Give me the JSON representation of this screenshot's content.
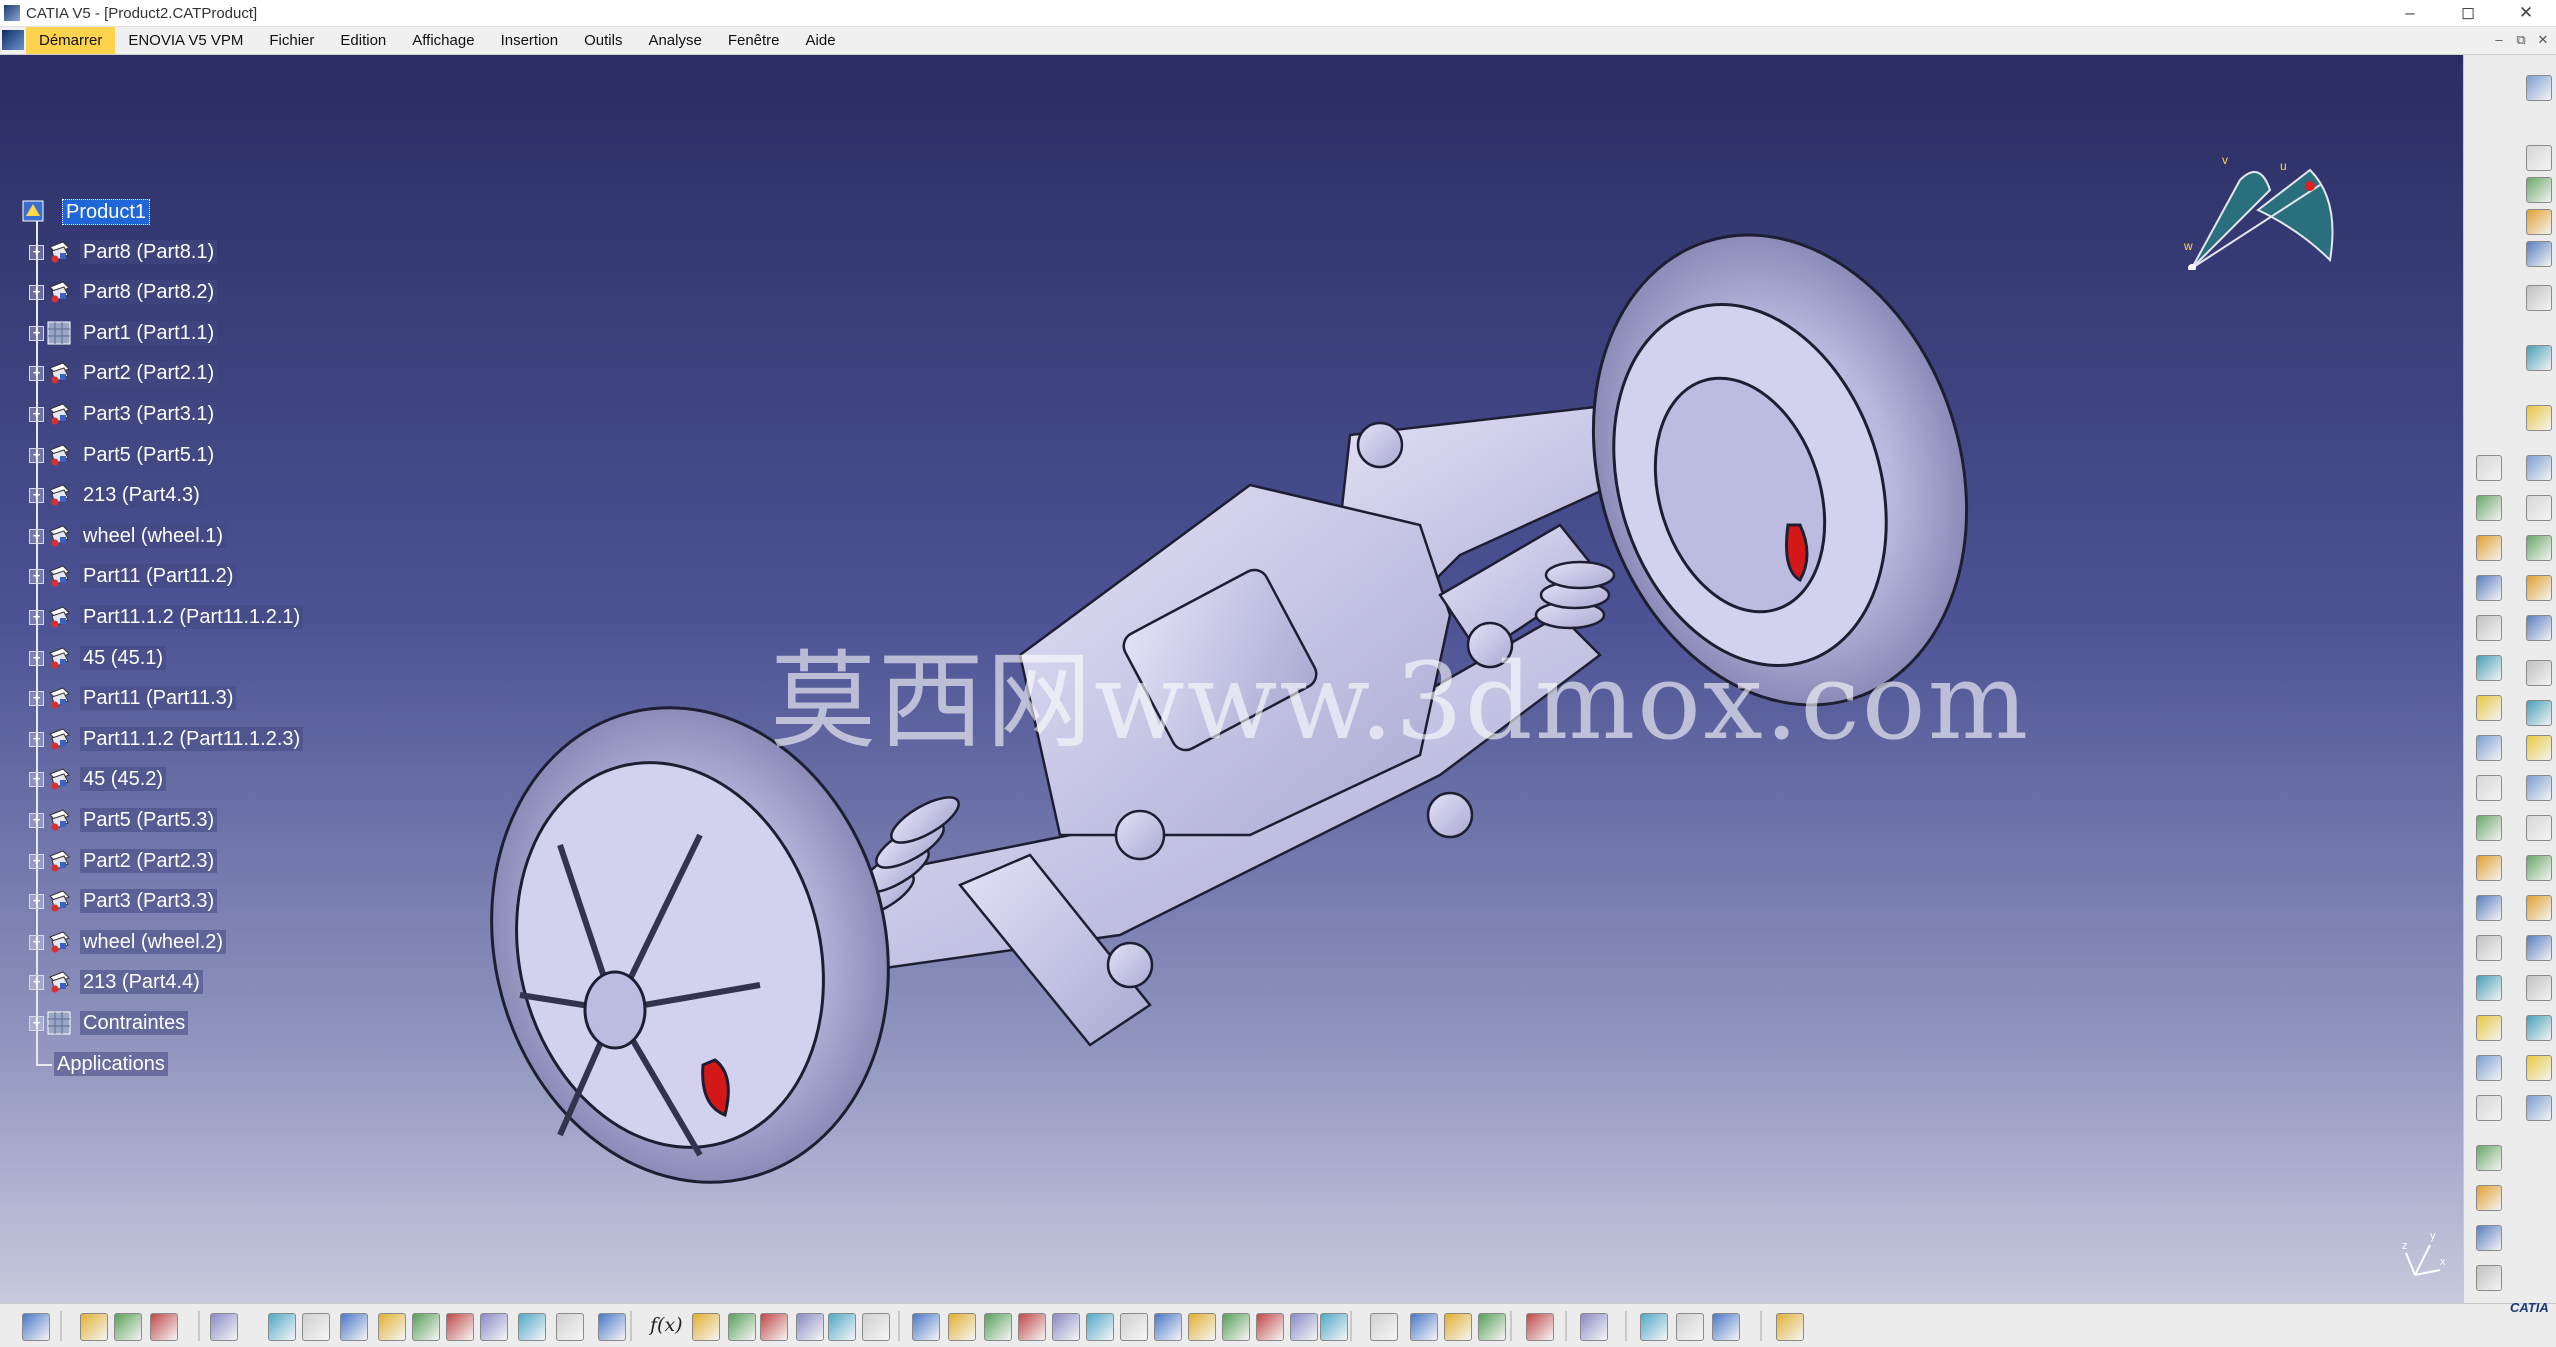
{
  "window": {
    "title": "CATIA V5 - [Product2.CATProduct]",
    "controls": [
      "–",
      "◻",
      "✕"
    ]
  },
  "menu": {
    "items": [
      "Démarrer",
      "ENOVIA V5 VPM",
      "Fichier",
      "Edition",
      "Affichage",
      "Insertion",
      "Outils",
      "Analyse",
      "Fenêtre",
      "Aide"
    ],
    "active": "Démarrer",
    "mdi_controls": [
      "–",
      "⧉",
      "✕"
    ]
  },
  "tree": {
    "root": "Product1",
    "items": [
      {
        "label": "Part8 (Part8.1)",
        "icon": "part-icon"
      },
      {
        "label": "Part8 (Part8.2)",
        "icon": "part-icon"
      },
      {
        "label": "Part1 (Part1.1)",
        "icon": "part-grid-icon"
      },
      {
        "label": "Part2 (Part2.1)",
        "icon": "part-icon"
      },
      {
        "label": "Part3 (Part3.1)",
        "icon": "part-icon"
      },
      {
        "label": "Part5 (Part5.1)",
        "icon": "part-icon"
      },
      {
        "label": "213 (Part4.3)",
        "icon": "part-icon"
      },
      {
        "label": "wheel (wheel.1)",
        "icon": "part-icon"
      },
      {
        "label": "Part11 (Part11.2)",
        "icon": "part-icon"
      },
      {
        "label": "Part11.1.2 (Part11.1.2.1)",
        "icon": "part-icon"
      },
      {
        "label": "45 (45.1)",
        "icon": "part-icon"
      },
      {
        "label": "Part11 (Part11.3)",
        "icon": "part-icon"
      },
      {
        "label": "Part11.1.2 (Part11.1.2.3)",
        "icon": "part-icon"
      },
      {
        "label": "45 (45.2)",
        "icon": "part-icon"
      },
      {
        "label": "Part5 (Part5.3)",
        "icon": "part-icon"
      },
      {
        "label": "Part2 (Part2.3)",
        "icon": "part-icon"
      },
      {
        "label": "Part3 (Part3.3)",
        "icon": "part-icon"
      },
      {
        "label": "wheel (wheel.2)",
        "icon": "part-icon"
      },
      {
        "label": "213 (Part4.4)",
        "icon": "part-icon"
      },
      {
        "label": "Contraintes",
        "icon": "constraints-icon"
      }
    ],
    "footer": "Applications"
  },
  "viewport": {
    "watermark": "莫西网www.3dmox.com",
    "compass_labels": {
      "v": "v",
      "u": "u",
      "w": "w"
    },
    "axis_labels": {
      "x": "x",
      "y": "y",
      "z": "z"
    }
  },
  "toolbars": {
    "formula_label": "f(x)",
    "brand": "CATIA"
  },
  "colors": {
    "viewport_top": "#2a2d62",
    "viewport_bottom": "#c8c9dd",
    "selection": "#1f66d8",
    "menu_active": "#ffd34d",
    "model_fill": "#c9c8e8",
    "brake_caliper": "#d41818"
  }
}
